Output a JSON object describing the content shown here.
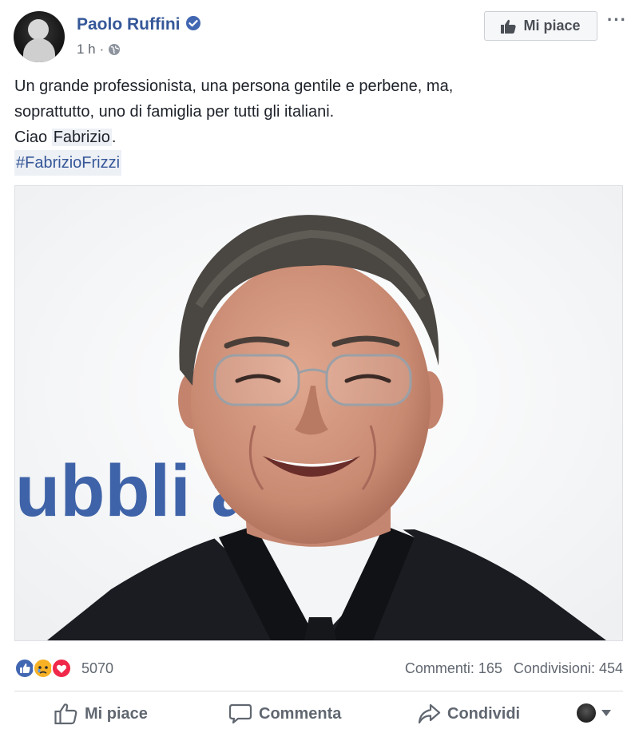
{
  "post": {
    "author": "Paolo Ruffini",
    "time": "1 h",
    "separator": "·",
    "text_line1": "Un grande professionista, una persona gentile e perbene, ma,",
    "text_line2": "soprattutto, uno di famiglia per tutti gli italiani.",
    "text_ciao": "Ciao ",
    "mention": "Fabrizio",
    "text_period": ".",
    "hashtag": "#FabrizioFrizzi"
  },
  "header": {
    "like_page_label": "Mi piace",
    "more_label": "···"
  },
  "reactions": {
    "icons": [
      "like-reaction-icon",
      "sad-reaction-icon",
      "love-reaction-icon"
    ],
    "count": "5070"
  },
  "stats": {
    "comments": "Commenti: 165",
    "shares": "Condivisioni: 454"
  },
  "actions": {
    "like": "Mi piace",
    "comment": "Commenta",
    "share": "Condividi"
  },
  "photo": {
    "backdrop_text": "ubbli a"
  },
  "colors": {
    "link_blue": "#365899",
    "facebook_blue": "#4267b2",
    "meta_gray": "#616770",
    "love_red": "#f0284a",
    "sad_yellow": "#f7b125"
  }
}
